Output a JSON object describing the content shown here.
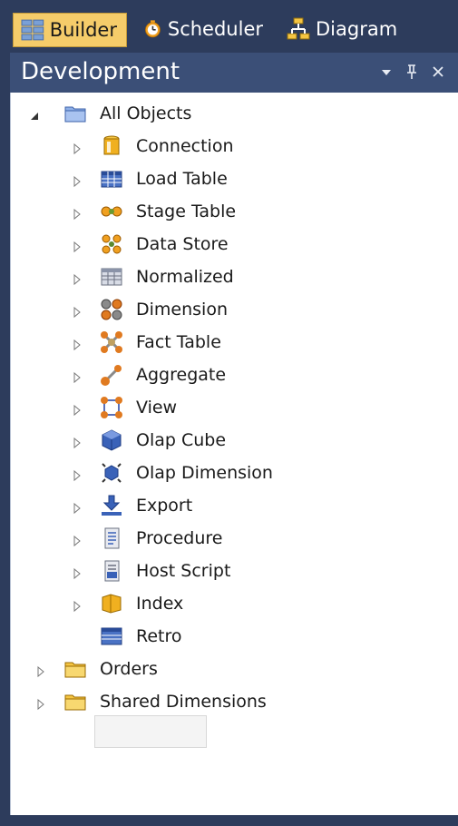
{
  "tabs": [
    {
      "label": "Builder",
      "icon": "builder-icon",
      "active": true
    },
    {
      "label": "Scheduler",
      "icon": "clock-icon",
      "active": false
    },
    {
      "label": "Diagram",
      "icon": "diagram-icon",
      "active": false
    }
  ],
  "panel": {
    "title": "Development",
    "buttons": {
      "dropdown": "▾",
      "pin": "ᅟ",
      "close": "×"
    }
  },
  "tree": {
    "root": {
      "label": "All Objects",
      "icon": "folder-blue-icon",
      "expanded": true
    },
    "children": [
      {
        "label": "Connection",
        "icon": "connection-icon"
      },
      {
        "label": "Load Table",
        "icon": "load-table-icon"
      },
      {
        "label": "Stage Table",
        "icon": "stage-table-icon"
      },
      {
        "label": "Data Store",
        "icon": "data-store-icon"
      },
      {
        "label": "Normalized",
        "icon": "normalized-icon"
      },
      {
        "label": "Dimension",
        "icon": "dimension-icon"
      },
      {
        "label": "Fact Table",
        "icon": "fact-table-icon"
      },
      {
        "label": "Aggregate",
        "icon": "aggregate-icon"
      },
      {
        "label": "View",
        "icon": "view-icon"
      },
      {
        "label": "Olap Cube",
        "icon": "olap-cube-icon"
      },
      {
        "label": "Olap Dimension",
        "icon": "olap-dimension-icon"
      },
      {
        "label": "Export",
        "icon": "export-icon"
      },
      {
        "label": "Procedure",
        "icon": "procedure-icon"
      },
      {
        "label": "Host Script",
        "icon": "host-script-icon"
      },
      {
        "label": "Index",
        "icon": "index-icon"
      },
      {
        "label": "Retro",
        "icon": "retro-icon",
        "selected": true,
        "no_expander": true
      }
    ],
    "siblings": [
      {
        "label": "Orders",
        "icon": "folder-yellow-icon"
      },
      {
        "label": "Shared Dimensions",
        "icon": "folder-yellow-icon"
      }
    ]
  },
  "colors": {
    "accent_tab": "#f5cc6a",
    "header_bg": "#3b4f77",
    "frame_bg": "#2d3c5c"
  }
}
